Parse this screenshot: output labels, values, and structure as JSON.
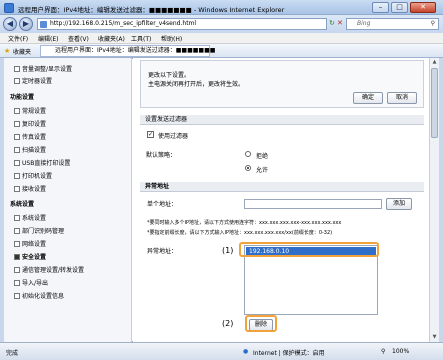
{
  "window": {
    "title": "远程用户界面：IPv4地址：编辑发送过滤器：■■■■■■■ - Windows Internet Explorer"
  },
  "address": {
    "url": "http://192.168.0.215/m_sec_ipfilter_v4send.html",
    "search_placeholder": "Bing"
  },
  "menu": [
    "文件(F)",
    "编辑(E)",
    "查看(V)",
    "收藏夹(A)",
    "工具(T)",
    "帮助(H)"
  ],
  "favorites": {
    "label": "收藏夹",
    "tab": "远程用户界面：IPv4地址：编辑发送过滤器：■■■■■■■"
  },
  "sidebar": {
    "items_top": [
      "音量调整/显示设置",
      "定时器设置"
    ],
    "section1": "功能设置",
    "items1": [
      "常规设置",
      "复印设置",
      "传真设置",
      "扫描设置",
      "USB直接打印设置",
      "打印机设置",
      "接收设置"
    ],
    "section2": "系统设置",
    "items2": [
      "系统设置",
      "部门识别码管理",
      "网络设置",
      "安全设置",
      "通信管理设置/转发设置",
      "导入/导出",
      "初始化设置信息"
    ]
  },
  "notice": {
    "line1": "更改以下设置。",
    "line2": "主电源关闭再打开后，更改将生效。",
    "ok": "确定",
    "cancel": "取消"
  },
  "filter": {
    "header": "设置发送过滤器",
    "use_label": "使用过滤器",
    "policy_label": "默认策略：",
    "reject": "拒绝",
    "allow": "允许"
  },
  "except": {
    "header": "异常地址",
    "single_label": "单个地址：",
    "add_button": "添加",
    "hint1": "*要同时输入多个IP地址，请以下方式使用连字符：xxx.xxx.xxx.xxx-xxx.xxx.xxx.xxx",
    "hint2": "*要指定前缀长度，请以下方式输入IP地址：xxx.xxx.xxx.xxx/xx(前缀长度：0-32)",
    "list_label": "异常地址：",
    "list_items": [
      "192.168.0.10"
    ],
    "delete_button": "删除"
  },
  "callouts": [
    "(1)",
    "(2)"
  ],
  "status": {
    "left": "完成",
    "zone": "Internet | 保护模式：启用",
    "zoom": "100%"
  }
}
